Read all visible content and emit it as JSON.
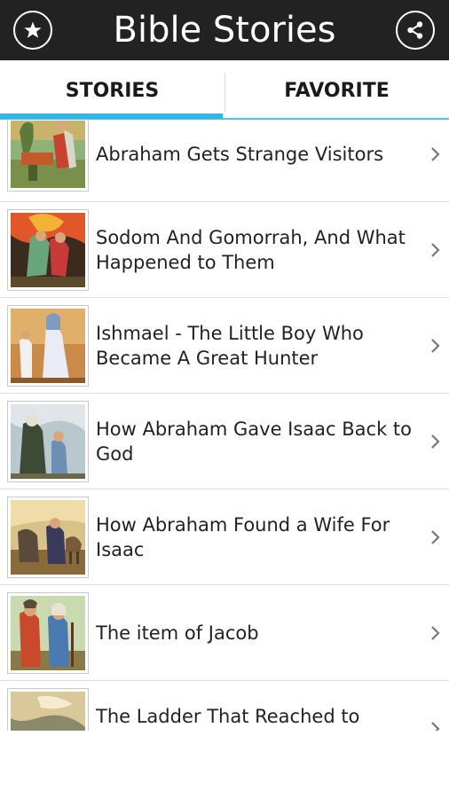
{
  "app": {
    "title": "Bible Stories",
    "favorites_icon": "star-icon",
    "share_icon": "share-icon"
  },
  "tabs": [
    {
      "label": "STORIES",
      "selected": true
    },
    {
      "label": "FAVORITE",
      "selected": false
    }
  ],
  "stories": [
    {
      "title": "Abraham Gets Strange Visitors",
      "thumb_icon": "illustration-image"
    },
    {
      "title": "Sodom And Gomorrah, And What Happened to Them",
      "thumb_icon": "illustration-image"
    },
    {
      "title": "Ishmael - The Little Boy Who Became A Great Hunter",
      "thumb_icon": "illustration-image"
    },
    {
      "title": "How Abraham Gave Isaac Back to God",
      "thumb_icon": "illustration-image"
    },
    {
      "title": "How Abraham Found a Wife For Isaac",
      "thumb_icon": "illustration-image"
    },
    {
      "title": "The item of Jacob",
      "thumb_icon": "illustration-image"
    },
    {
      "title": "The Ladder That Reached to",
      "thumb_icon": "illustration-image"
    }
  ],
  "colors": {
    "topbar": "#222222",
    "tab_indicator": "#33b5e5",
    "row_divider": "#e0e0e0",
    "text": "#222222"
  }
}
